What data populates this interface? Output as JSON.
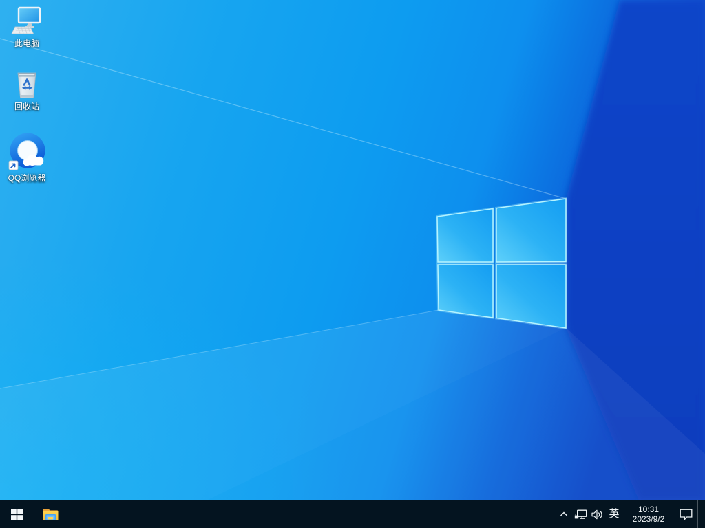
{
  "desktop": {
    "icons": [
      {
        "id": "this-pc",
        "label": "此电脑"
      },
      {
        "id": "recycle-bin",
        "label": "回收站"
      },
      {
        "id": "qq-browser",
        "label": "QQ浏览器"
      }
    ],
    "wallpaper": {
      "description": "windows-10-light-logo",
      "colors": {
        "left": "#2fb0f0",
        "mid": "#0d9cf0",
        "right": "#0a40c2",
        "logo_fill": "#27aef4",
        "logo_edge": "#b6f4ff"
      }
    }
  },
  "taskbar": {
    "color": "#041420",
    "buttons": [
      "start",
      "file-explorer"
    ],
    "tray": {
      "icons": [
        "chevron-up",
        "ethernet",
        "speaker",
        "action-center"
      ],
      "language": "英",
      "time": "10:31",
      "date": "2023/9/2"
    }
  }
}
